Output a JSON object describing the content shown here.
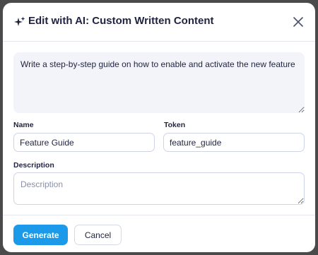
{
  "modal": {
    "title": "Edit with AI: Custom Written Content"
  },
  "prompt": {
    "value": "Write a step-by-step guide on how to enable and activate the new feature"
  },
  "name_field": {
    "label": "Name",
    "value": "Feature Guide"
  },
  "token_field": {
    "label": "Token",
    "value": "feature_guide"
  },
  "description_field": {
    "label": "Description",
    "placeholder": "Description",
    "value": ""
  },
  "footer": {
    "generate_label": "Generate",
    "cancel_label": "Cancel"
  },
  "icons": {
    "title_icon": "sparkle-icon",
    "close_icon": "close-icon"
  },
  "colors": {
    "primary": "#1a9ae8",
    "text": "#1f2340",
    "prompt_bg": "#f3f4f9"
  }
}
